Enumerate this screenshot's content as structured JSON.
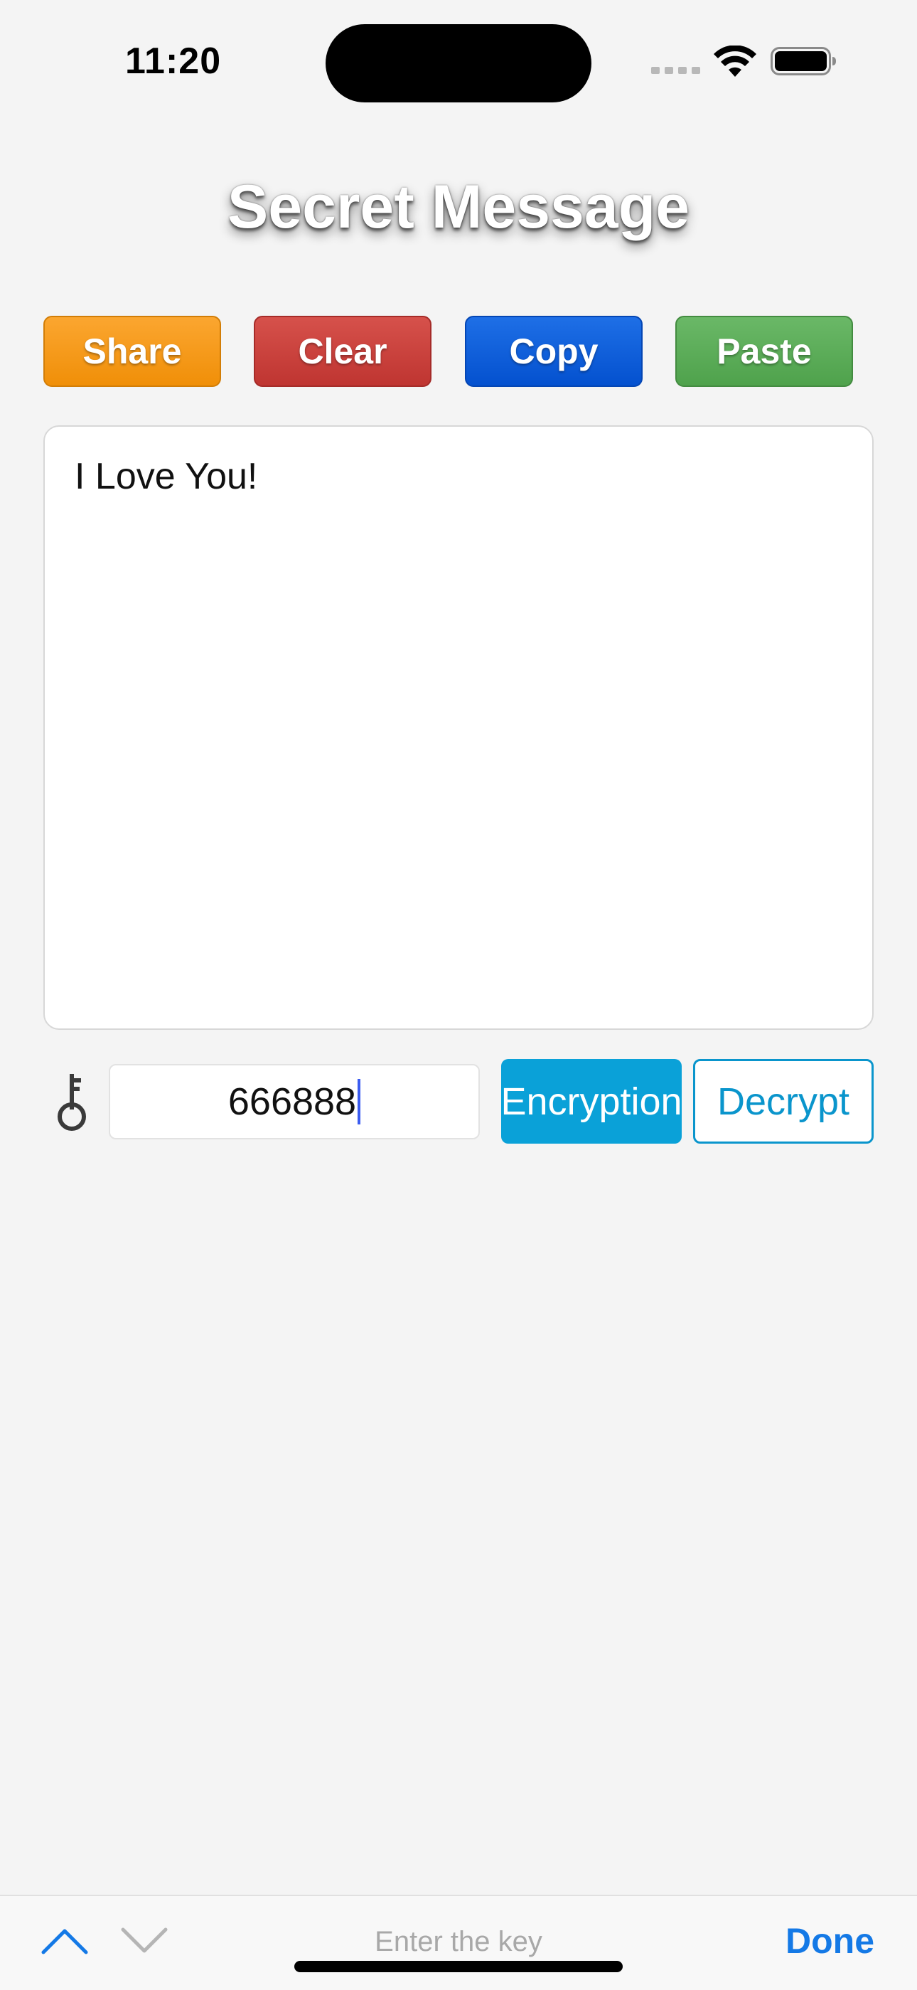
{
  "status_bar": {
    "time": "11:20",
    "icons": [
      "cellular-signal-icon",
      "wifi-icon",
      "battery-icon"
    ]
  },
  "app": {
    "title": "Secret Message"
  },
  "actions": {
    "share_label": "Share",
    "clear_label": "Clear",
    "copy_label": "Copy",
    "paste_label": "Paste",
    "colors": {
      "share": "#f5981a",
      "clear": "#c8403b",
      "copy": "#0a5fdc",
      "paste": "#5cac59"
    }
  },
  "message": {
    "text": "I Love You!"
  },
  "key_row": {
    "icon": "key-icon",
    "key_value": "666888",
    "encrypt_label": "Encryption",
    "decrypt_label": "Decrypt",
    "accent_color": "#0aa1d8"
  },
  "keyboard_toolbar": {
    "hint": "Enter the key",
    "done_label": "Done",
    "icons": [
      "chevron-up-icon",
      "chevron-down-icon"
    ]
  }
}
